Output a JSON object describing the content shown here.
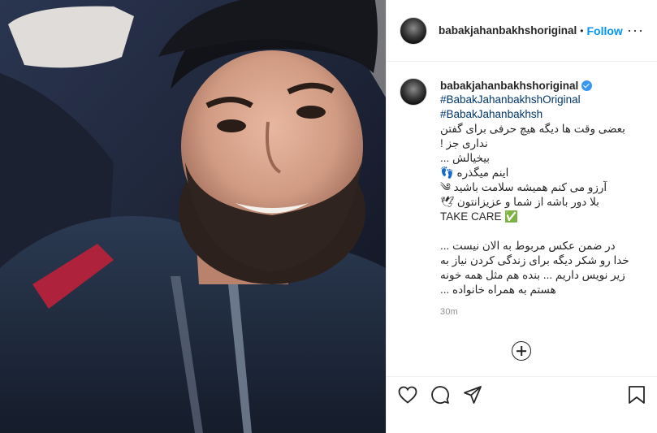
{
  "post": {
    "username": "babakjahanbakhshoriginal",
    "separator": "•",
    "follow_label": "Follow",
    "more_label": "···"
  },
  "caption": {
    "username": "babakjahanbakhshoriginal",
    "hashtags": [
      "#BabakJahanbakhshOriginal",
      "#BabakJahanbakhsh"
    ],
    "lines": [
      "بعضی وقت ها دیگه هیچ حرفی برای گفتن",
      "نداری جز !",
      "بیخیالش ...",
      "اینم میگذره 👣",
      "آرزو می کنم همیشه سلامت باشید ༄",
      "بلا دور باشه از شما و عزیزانتون 🕊",
      "TAKE CARE ✅"
    ],
    "lines2": [
      "در ضمن عکس مربوط به الان نیست ...",
      "خدا رو شکر دیگه برای زندگی کردن نیاز به",
      "زیر نویس داریم ... بنده هم مثل همه خونه",
      "هستم به همراه خانواده ..."
    ],
    "timestamp": "30m"
  },
  "icons": {
    "like": "heart-icon",
    "comment": "comment-icon",
    "share": "share-icon",
    "save": "bookmark-icon",
    "load_more": "plus-circle-icon",
    "verified": "verified-badge-icon"
  },
  "colors": {
    "follow": "#0095f6",
    "hashtag": "#00376b",
    "verified": "#3897f0",
    "muted": "#8e8e8e"
  }
}
